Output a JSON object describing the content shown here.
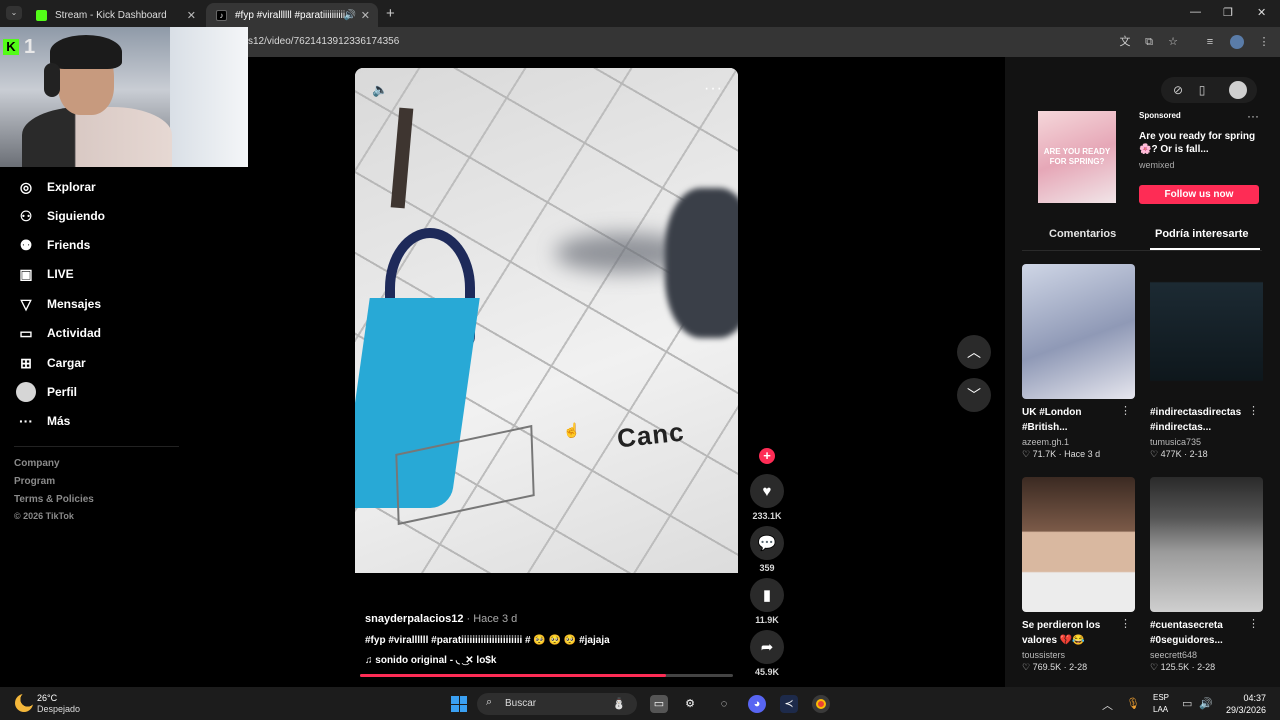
{
  "browser": {
    "tabs": [
      {
        "title": "Stream - Kick Dashboard",
        "favicon_color": "#53fc18"
      },
      {
        "title": "#fyp #virallllll #paratiiiiiiiiiii...",
        "favicon_color": "#ffffff"
      }
    ],
    "url": "s12/video/7621413912336174356"
  },
  "stream_overlay": {
    "logo_text": "K",
    "number": "1"
  },
  "nav": {
    "items": [
      {
        "label": "Explorar",
        "icon": "compass-icon"
      },
      {
        "label": "Siguiendo",
        "icon": "user-follow-icon"
      },
      {
        "label": "Friends",
        "icon": "friends-icon"
      },
      {
        "label": "LIVE",
        "icon": "live-icon"
      },
      {
        "label": "Mensajes",
        "icon": "send-icon"
      },
      {
        "label": "Actividad",
        "icon": "activity-icon"
      },
      {
        "label": "Cargar",
        "icon": "upload-icon"
      },
      {
        "label": "Perfil",
        "icon": "avatar"
      },
      {
        "label": "Más",
        "icon": "more-icon"
      }
    ],
    "footer": [
      "Company",
      "Program",
      "Terms & Policies",
      "© 2026 TikTok"
    ]
  },
  "video": {
    "overlay_text": "Canc",
    "author": "snayderpalacios12",
    "time": " · Hace 3 d",
    "caption": "#fyp #virallllll #paratiiiiiiiiiiiiiiiiiiiiii # 🥺 🥺 🥺 #jajaja",
    "sound": "♫  sonido original - ◟ ͜ ✕ lo$k",
    "progress": 0.82,
    "likes": "233.1K",
    "comments": "359",
    "saves": "11.9K",
    "shares": "45.9K"
  },
  "ad": {
    "thumb_text": "ARE YOU READY FOR SPRING?",
    "label": "Sponsored",
    "title": "Are you ready for spring 🌸? Or is fall...",
    "brand": "wemixed",
    "button": "Follow us now"
  },
  "right_tabs": {
    "comments": "Comentarios",
    "suggested": "Podría interesarte"
  },
  "cards": [
    {
      "title": "UK #London #British...",
      "user": "azeem.gh.1",
      "stats": "♡ 71.7K · Hace 3 d"
    },
    {
      "title": "#indirectasdirectas #indirectas...",
      "user": "tumusica735",
      "stats": "♡ 477K · 2-18"
    },
    {
      "title": "Se perdieron los valores 💔😂",
      "user": "toussisters",
      "stats": "♡ 769.5K · 2-28"
    },
    {
      "title": "#cuentasecreta #0seguidores...",
      "user": "seecrett648",
      "stats": "♡ 125.5K · 2-28"
    }
  ],
  "taskbar": {
    "temp": "26°C",
    "weather": "Despejado",
    "search": "Buscar",
    "lang1": "ESP",
    "lang2": "LAA",
    "time": "04:37",
    "date": "29/3/2026"
  },
  "colors": {
    "accent": "#fe2c55",
    "kick": "#53fc18"
  }
}
